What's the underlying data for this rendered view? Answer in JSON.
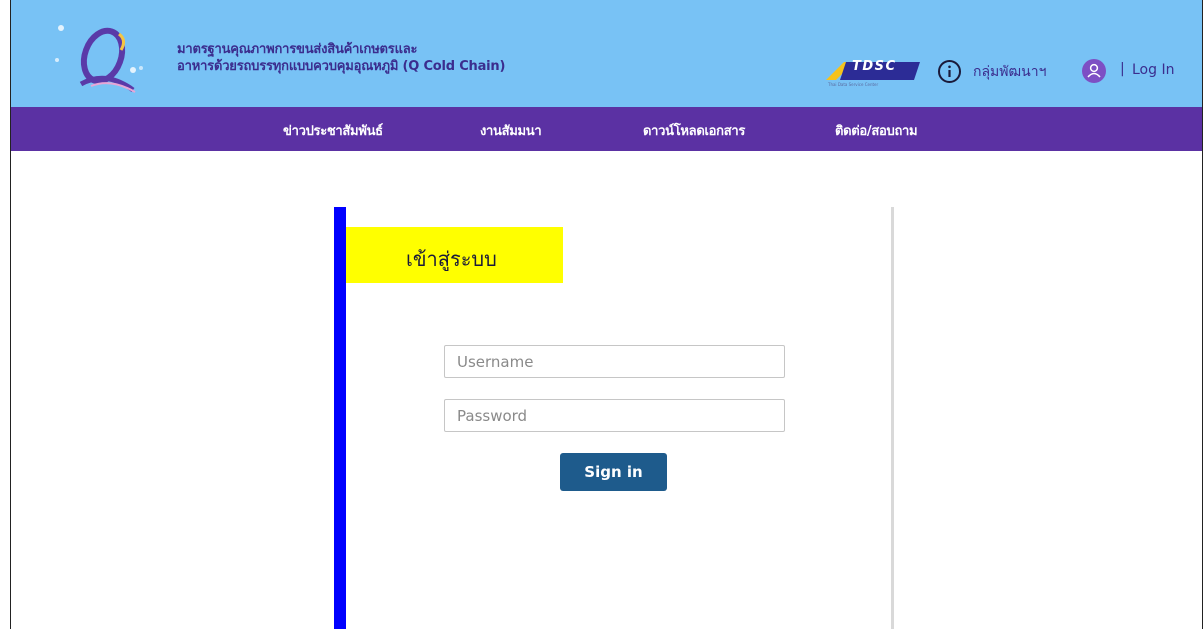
{
  "header": {
    "title_line1": "มาตรฐานคุณภาพการขนส่งสินค้าเกษตรและ",
    "title_line2": "อาหารด้วยรถบรรทุกแบบควบคุมอุณหภูมิ (Q Cold Chain)",
    "logo_icon": "q-cold-chain-logo",
    "partner_logo": {
      "text": "TDSC",
      "subtext": "Thai Data Service Center"
    },
    "group_link": "กลุ่มพัฒนาฯ",
    "separator": "|",
    "login_link": "Log In"
  },
  "nav": {
    "items": [
      {
        "label": "ข่าวประชาสัมพันธ์"
      },
      {
        "label": "งานสัมมนา"
      },
      {
        "label": "ดาวน์โหลดเอกสาร"
      },
      {
        "label": "ติดต่อ/สอบถาม"
      }
    ]
  },
  "login": {
    "title": "เข้าสู่ระบบ",
    "username_placeholder": "Username",
    "password_placeholder": "Password",
    "signin_label": "Sign in"
  },
  "colors": {
    "header_bg": "#78c2f5",
    "nav_bg": "#5b31a3",
    "accent_bar": "#0000ff",
    "title_highlight": "#ffff00",
    "button": "#1e5b8c"
  }
}
